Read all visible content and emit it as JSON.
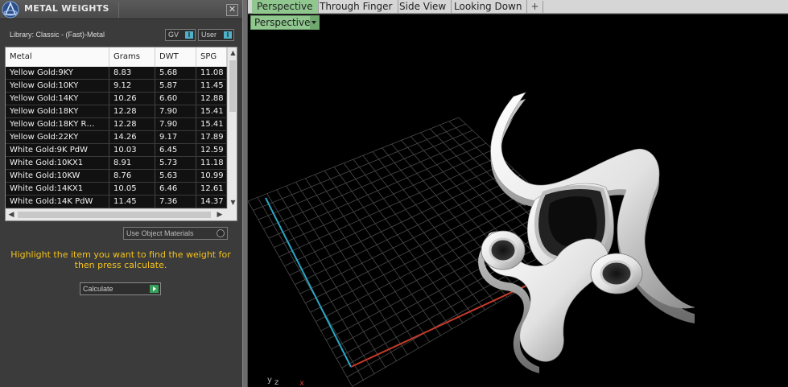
{
  "panel": {
    "title": "METAL WEIGHTS",
    "close_label": "✕",
    "library_label": "Library: Classic - (Fast)-Metal",
    "toggle_gv": {
      "label": "GV",
      "knob": "I"
    },
    "toggle_user": {
      "label": "User",
      "knob": "I"
    },
    "table": {
      "columns": [
        "Metal",
        "Grams",
        "DWT",
        "SPG"
      ],
      "rows": [
        [
          "Yellow Gold:9KY",
          "8.83",
          "5.68",
          "11.08"
        ],
        [
          "Yellow Gold:10KY",
          "9.12",
          "5.87",
          "11.45"
        ],
        [
          "Yellow Gold:14KY",
          "10.26",
          "6.60",
          "12.88"
        ],
        [
          "Yellow Gold:18KY",
          "12.28",
          "7.90",
          "15.41"
        ],
        [
          "Yellow Gold:18KY R…",
          "12.28",
          "7.90",
          "15.41"
        ],
        [
          "Yellow Gold:22KY",
          "14.26",
          "9.17",
          "17.89"
        ],
        [
          "White Gold:9K PdW",
          "10.03",
          "6.45",
          "12.59"
        ],
        [
          "White Gold:10KX1",
          "8.91",
          "5.73",
          "11.18"
        ],
        [
          "White Gold:10KW",
          "8.76",
          "5.63",
          "10.99"
        ],
        [
          "White Gold:14KX1",
          "10.05",
          "6.46",
          "12.61"
        ],
        [
          "White Gold:14K PdW",
          "11.45",
          "7.36",
          "14.37"
        ]
      ]
    },
    "use_object_materials": "Use Object Materials",
    "hint": "Highlight the item you want to find the weight for then press calculate.",
    "calculate_label": "Calculate"
  },
  "viewport": {
    "tabs": [
      "Perspective",
      "Through Finger",
      "Side View",
      "Looking Down"
    ],
    "add_tab": "+",
    "view_dropdown": "Perspective",
    "axis_labels": [
      "y",
      "z",
      "x"
    ]
  },
  "colors": {
    "accent_tab": "#8fc78f",
    "hint_text": "#f3c21a",
    "grid_line": "#4a4a4a",
    "axis_y": "#2aa7c4",
    "axis_x": "#c83a2a"
  }
}
